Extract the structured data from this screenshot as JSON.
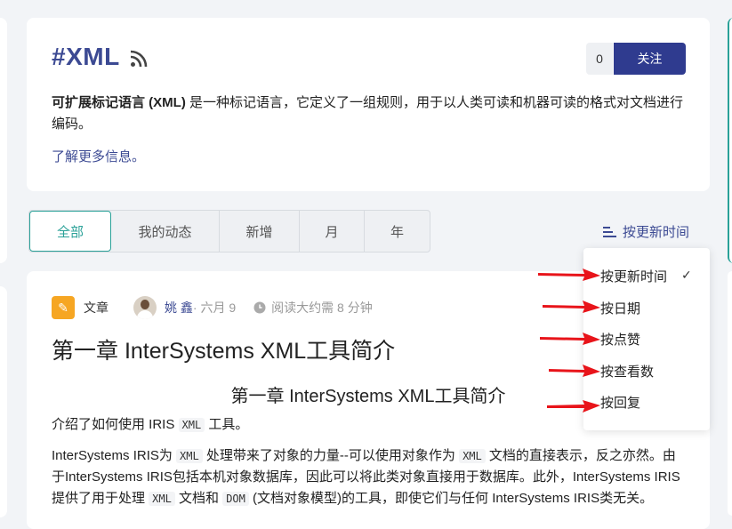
{
  "tag": {
    "title": "#XML",
    "follow_count": "0",
    "follow_label": "关注",
    "desc_bold": "可扩展标记语言 (XML)",
    "desc_rest": " 是一种标记语言，它定义了一组规则，用于以人类可读和机器可读的格式对文档进行编码。",
    "more_link": "了解更多信息。"
  },
  "tabs": [
    {
      "label": "全部",
      "active": true
    },
    {
      "label": "我的动态"
    },
    {
      "label": "新增"
    },
    {
      "label": "月"
    },
    {
      "label": "年"
    }
  ],
  "sort": {
    "current": "按更新时间",
    "options": [
      "按更新时间",
      "按日期",
      "按点赞",
      "按查看数",
      "按回复"
    ],
    "check": "✓"
  },
  "article": {
    "type_label": "文章",
    "author": "姚 鑫",
    "date": " · 六月 9",
    "read_time": "阅读大约需 8 分钟",
    "title": "第一章 InterSystems XML工具简介",
    "subtitle": "第一章 InterSystems XML工具简介",
    "p1_a": "介绍了如何使用 IRIS ",
    "p1_code": "XML",
    "p1_b": " 工具。",
    "p2_a": "InterSystems IRIS为 ",
    "p2_code1": "XML",
    "p2_b": " 处理带来了对象的力量--可以使用对象作为 ",
    "p2_code2": "XML",
    "p2_c": " 文档的直接表示，反之亦然。由于InterSystems IRIS包括本机对象数据库，因此可以将此类对象直接用于数据库。此外，InterSystems IRIS提供了用于处理 ",
    "p2_code3": "XML",
    "p2_d": " 文档和 ",
    "p2_code4": "DOM",
    "p2_e": " (文档对象模型)的工具，即使它们与任何 InterSystems IRIS类无关。"
  },
  "colors": {
    "brand": "#3c4a93",
    "active_tab": "#2aa198",
    "follow_bg": "#2f3b8f",
    "arrow": "#e8141a",
    "type_icon": "#f6a623"
  }
}
